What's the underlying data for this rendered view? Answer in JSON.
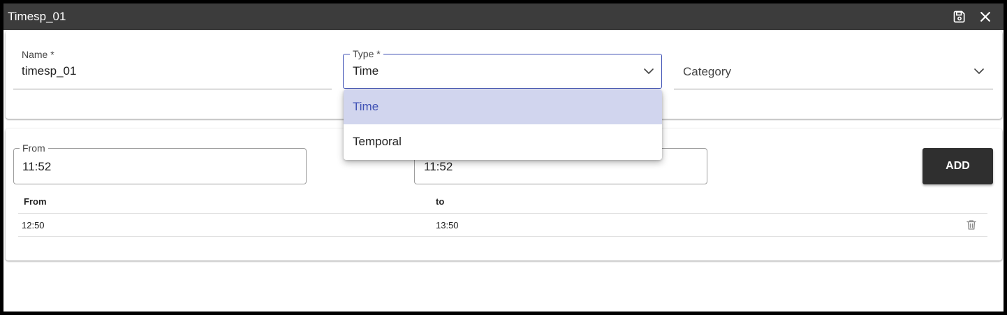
{
  "window": {
    "title": "Timesp_01"
  },
  "form": {
    "name": {
      "label": "Name *",
      "value": "timesp_01"
    },
    "type": {
      "label": "Type *",
      "value": "Time"
    },
    "category": {
      "placeholder": "Category"
    }
  },
  "dropdown": {
    "options": [
      "Time",
      "Temporal"
    ],
    "selected": "Time"
  },
  "range": {
    "from": {
      "label": "From",
      "value": "11:52"
    },
    "to": {
      "value": "11:52"
    },
    "add_label": "ADD"
  },
  "table": {
    "headers": [
      "From",
      "to"
    ],
    "rows": [
      {
        "from": "12:50",
        "to": "13:50"
      }
    ]
  },
  "colors": {
    "titlebar": "#3c3c3c",
    "accent": "#3f51b5",
    "selected_option_bg": "#d1d5ee",
    "add_button": "#2f2f2f"
  },
  "icons": [
    "save-icon",
    "close-icon",
    "chevron-down-icon",
    "trash-icon"
  ]
}
